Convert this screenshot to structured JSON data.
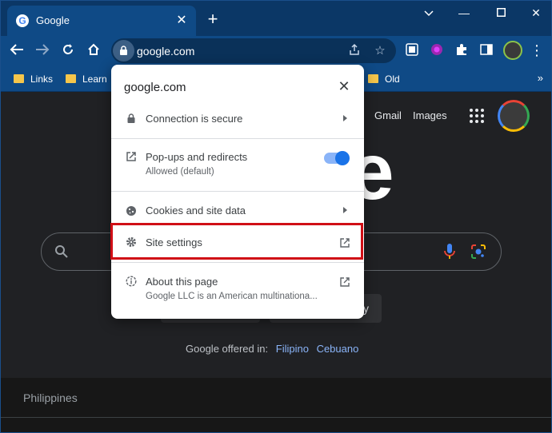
{
  "browser": {
    "tab": {
      "title": "Google",
      "favicon": "G"
    },
    "window_controls": [
      "chevron-down",
      "minimize",
      "maximize",
      "close"
    ],
    "address": "google.com",
    "bookmarks": [
      {
        "label": "Links"
      },
      {
        "label": "Learn"
      },
      {
        "label": "Old"
      }
    ],
    "bookmarks_more": "»"
  },
  "google_page": {
    "links": {
      "gmail": "Gmail",
      "images": "Images"
    },
    "logo_fragment": "e",
    "offered_in_label": "Google offered in:",
    "languages": [
      "Filipino",
      "Cebuano"
    ],
    "country": "Philippines"
  },
  "site_info_popup": {
    "title": "google.com",
    "connection": {
      "label": "Connection is secure"
    },
    "popups": {
      "label": "Pop-ups and redirects",
      "sub": "Allowed (default)",
      "enabled": true
    },
    "cookies": {
      "label": "Cookies and site data"
    },
    "site_settings": {
      "label": "Site settings",
      "highlighted": true,
      "highlight_color": "#d00f16"
    },
    "about": {
      "label": "About this page",
      "sub": "Google LLC is an American multinationa..."
    }
  }
}
